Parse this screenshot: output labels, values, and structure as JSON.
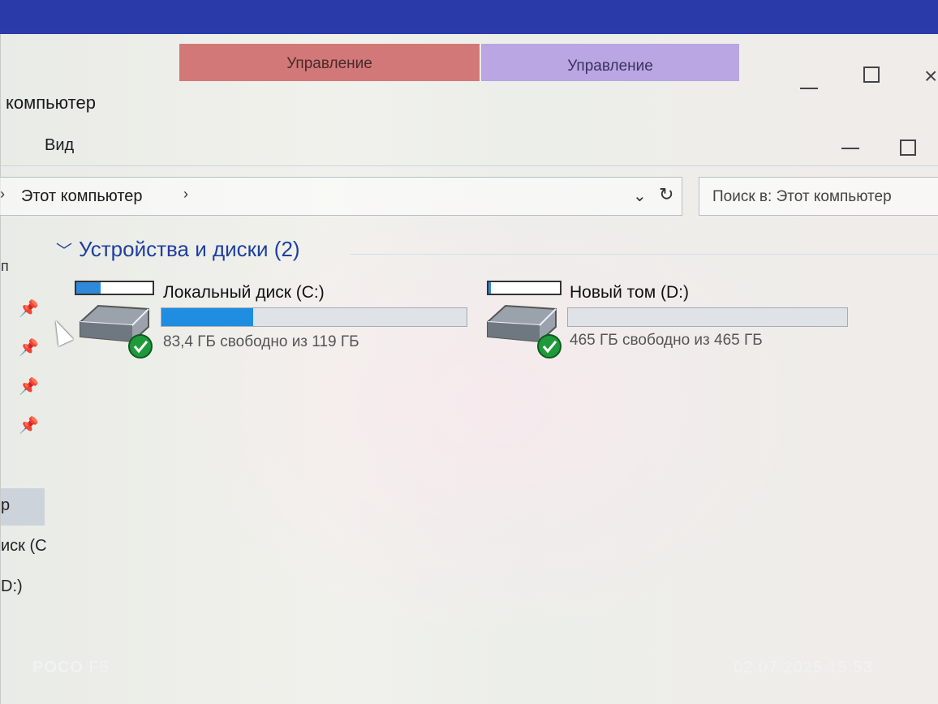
{
  "window": {
    "context_tabs": [
      "Управление",
      "Управление"
    ],
    "title": "компьютер",
    "ribbon_tab": "Вид",
    "close_glyph": "×"
  },
  "address": {
    "path": "Этот компьютер",
    "search_placeholder": "Поиск в: Этот компьютер"
  },
  "nav": {
    "partial_letter": "п",
    "selected_label": "р",
    "drive_c_label": "иск (С",
    "drive_d_label": "D:)"
  },
  "content": {
    "group_title": "Устройства и диски (2)",
    "drives": [
      {
        "name": "Локальный диск (C:)",
        "free_text": "83,4 ГБ свободно из 119 ГБ",
        "used_fraction": 0.3
      },
      {
        "name": "Новый том (D:)",
        "free_text": "465 ГБ свободно из 465 ГБ",
        "used_fraction": 0.0
      }
    ]
  },
  "photo_watermark": {
    "brand": "POCO",
    "model": "F5",
    "datetime": "02.07.2025  15:53"
  },
  "colors": {
    "context_tab_1": "#d27878",
    "context_tab_2": "#b9a6e2",
    "group_title": "#1e3f9e",
    "usage_bar": "#1f8de0",
    "status_check": "#1e9a3a"
  },
  "icons": [
    "pin-icon",
    "hard-drive-icon",
    "status-check-icon",
    "refresh-icon",
    "chevron-down-icon"
  ]
}
